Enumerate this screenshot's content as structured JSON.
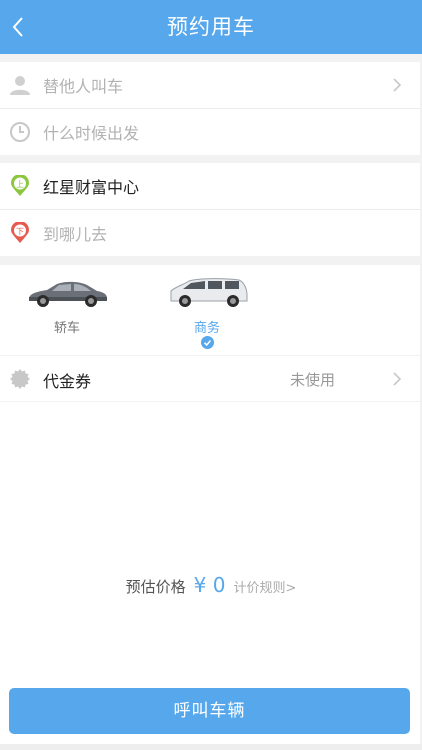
{
  "header": {
    "title": "预约用车"
  },
  "passenger": {
    "placeholder": "替他人叫车"
  },
  "time": {
    "placeholder": "什么时候出发"
  },
  "pickup": {
    "value": "红星财富中心",
    "badge": "上"
  },
  "dropoff": {
    "placeholder": "到哪儿去",
    "badge": "下"
  },
  "cars": [
    {
      "label": "轿车",
      "selected": false
    },
    {
      "label": "商务",
      "selected": true
    }
  ],
  "coupon": {
    "label": "代金券",
    "status": "未使用"
  },
  "estimate": {
    "label": "预估价格",
    "amount": "¥ 0",
    "rules_link": "计价规则>"
  },
  "call_button": {
    "label": "呼叫车辆"
  },
  "colors": {
    "accent": "#56a7ec",
    "pickup_green": "#8cc63f",
    "dropoff_red": "#e55b4f"
  }
}
